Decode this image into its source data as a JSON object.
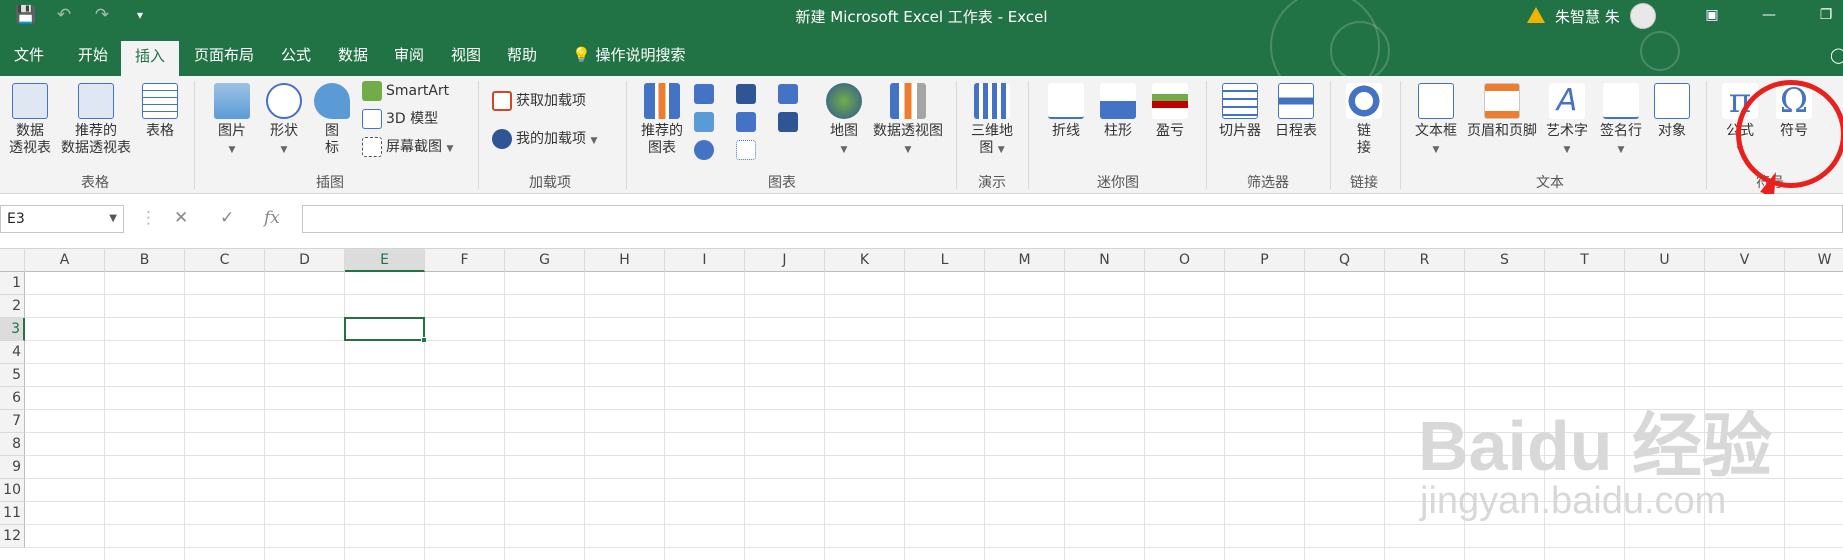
{
  "window": {
    "title": "新建 Microsoft Excel 工作表  -  Excel",
    "user": "朱智慧 朱"
  },
  "tabs": [
    "文件",
    "开始",
    "插入",
    "页面布局",
    "公式",
    "数据",
    "审阅",
    "视图",
    "帮助"
  ],
  "tell_me": "操作说明搜索",
  "ribbon": {
    "tables": {
      "pivot": "数据\n透视表",
      "recommended_pivot": "推荐的\n数据透视表",
      "table": "表格",
      "group": "表格"
    },
    "illustrations": {
      "pictures": "图片",
      "shapes": "形状",
      "icons": "图\n标",
      "smartart": "SmartArt",
      "model3d": "3D 模型",
      "screenshot": "屏幕截图",
      "group": "插图"
    },
    "addins": {
      "get": "获取加载项",
      "my": "我的加载项",
      "group": "加载项"
    },
    "charts": {
      "recommended": "推荐的\n图表",
      "maps": "地图",
      "pivot_chart": "数据透视图",
      "group": "图表"
    },
    "tours": {
      "map3d": "三维地\n图",
      "group": "演示"
    },
    "sparklines": {
      "line": "折线",
      "column": "柱形",
      "winloss": "盈亏",
      "group": "迷你图"
    },
    "filters": {
      "slicer": "切片器",
      "timeline": "日程表",
      "group": "筛选器"
    },
    "links": {
      "link": "链\n接",
      "group": "链接"
    },
    "text": {
      "textbox": "文本框",
      "header_footer": "页眉和页脚",
      "wordart": "艺术字",
      "signature": "签名行",
      "object": "对象",
      "group": "文本"
    },
    "symbols": {
      "equation": "公式",
      "symbol": "符号",
      "group": "符号"
    }
  },
  "formula_bar": {
    "name_box": "E3",
    "value": ""
  },
  "columns": [
    "A",
    "B",
    "C",
    "D",
    "E",
    "F",
    "G",
    "H",
    "I",
    "J",
    "K",
    "L",
    "M",
    "N",
    "O",
    "P",
    "Q",
    "R",
    "S",
    "T",
    "U",
    "V",
    "W"
  ],
  "rows": [
    "1",
    "2",
    "3",
    "4",
    "5",
    "6",
    "7",
    "8",
    "9",
    "10",
    "11",
    "12"
  ],
  "active_cell": {
    "col": "E",
    "row": "3"
  },
  "watermark": {
    "brand": "Bai",
    "brand2": "du",
    "cn": "经验",
    "url": "jingyan.baidu.com"
  },
  "colors": {
    "accent": "#217346",
    "annotation": "#e8211d"
  }
}
